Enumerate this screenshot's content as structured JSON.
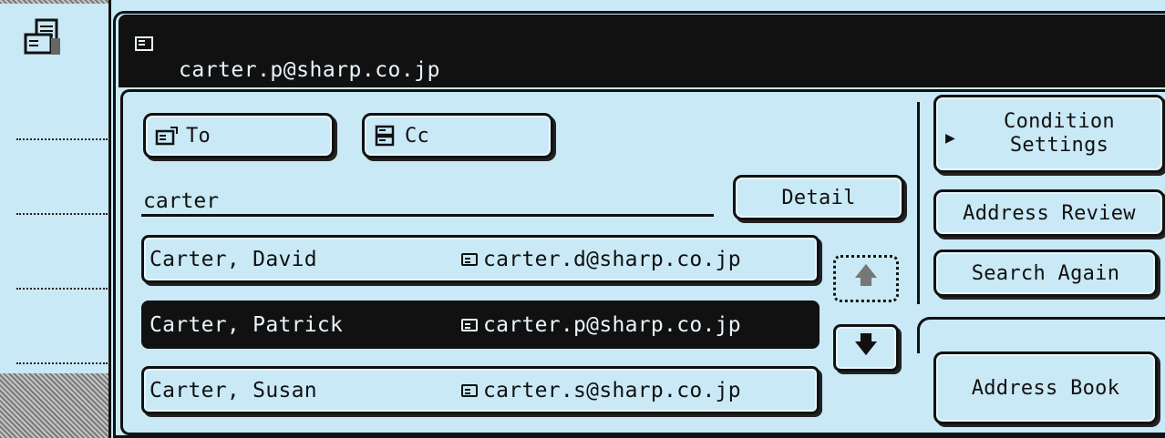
{
  "header": {
    "current_address": "carter.p@sharp.co.jp"
  },
  "recipient_type": {
    "to_label": "To",
    "cc_label": "Cc"
  },
  "search": {
    "value": "carter",
    "detail_label": "Detail"
  },
  "results": [
    {
      "name": "Carter, David",
      "email": "carter.d@sharp.co.jp",
      "selected": false
    },
    {
      "name": "Carter, Patrick",
      "email": "carter.p@sharp.co.jp",
      "selected": true
    },
    {
      "name": "Carter, Susan",
      "email": "carter.s@sharp.co.jp",
      "selected": false
    }
  ],
  "scroll": {
    "up_icon": "arrow-up-icon",
    "down_icon": "arrow-down-icon"
  },
  "side_buttons": {
    "condition_line1": "Condition",
    "condition_line2": "Settings",
    "address_review": "Address Review",
    "search_again": "Search Again",
    "address_book": "Address Book"
  },
  "colors": {
    "background": "#c9e9f6",
    "dark": "#111111",
    "inverse_text": "#e9f6fb"
  }
}
